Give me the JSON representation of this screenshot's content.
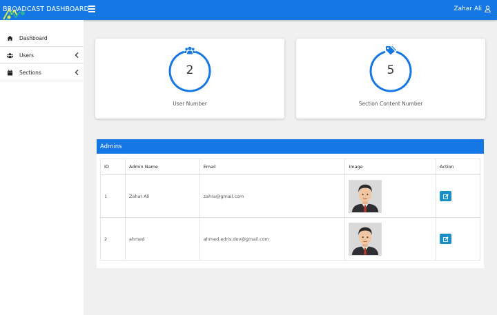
{
  "header": {
    "brand": "BROADCAST DASHBOARD",
    "user_name": "Zahar Ali"
  },
  "sidebar": {
    "items": [
      {
        "label": "Dashboard",
        "icon": "home-icon"
      },
      {
        "label": "Users",
        "icon": "users-icon"
      },
      {
        "label": "Sections",
        "icon": "calendar-icon"
      }
    ]
  },
  "stats": [
    {
      "value": "2",
      "caption": "User Number",
      "icon": "users-icon"
    },
    {
      "value": "5",
      "caption": "Section Content Number",
      "icon": "tags-icon"
    }
  ],
  "admins": {
    "title": "Admins",
    "columns": [
      "ID",
      "Admin Name",
      "Email",
      "Image",
      "Action"
    ],
    "rows": [
      {
        "id": "1",
        "name": "Zahar Ali",
        "email": "zahra@gmail.com"
      },
      {
        "id": "2",
        "name": "ahmed",
        "email": "ahmed.edris.dev@gmail.com"
      }
    ]
  },
  "colors": {
    "primary": "#1477e4",
    "action": "#1a8fc5"
  }
}
